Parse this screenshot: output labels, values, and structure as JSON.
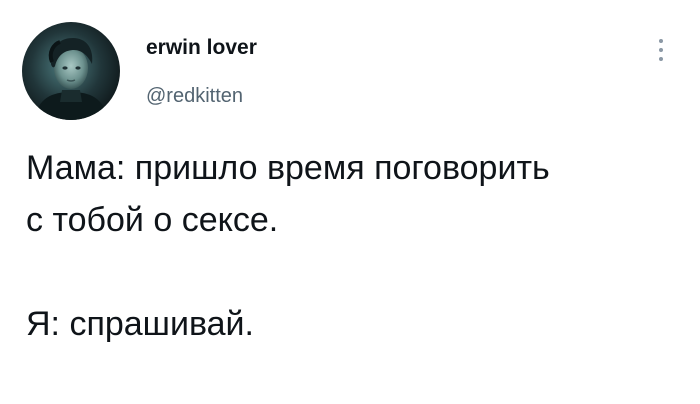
{
  "tweet": {
    "author": {
      "display_name": "erwin lover",
      "handle": "@redkitten",
      "avatar_icon": "user-avatar-photo"
    },
    "more_icon": "vertical-ellipsis-icon",
    "text_lines": [
      "Мама: пришло время поговорить",
      "с тобой о сексе.",
      "",
      "Я: спрашивай."
    ]
  },
  "colors": {
    "background": "#ffffff",
    "text_primary": "#0f1419",
    "text_secondary": "#536471",
    "icon_muted": "#8b98a5"
  }
}
